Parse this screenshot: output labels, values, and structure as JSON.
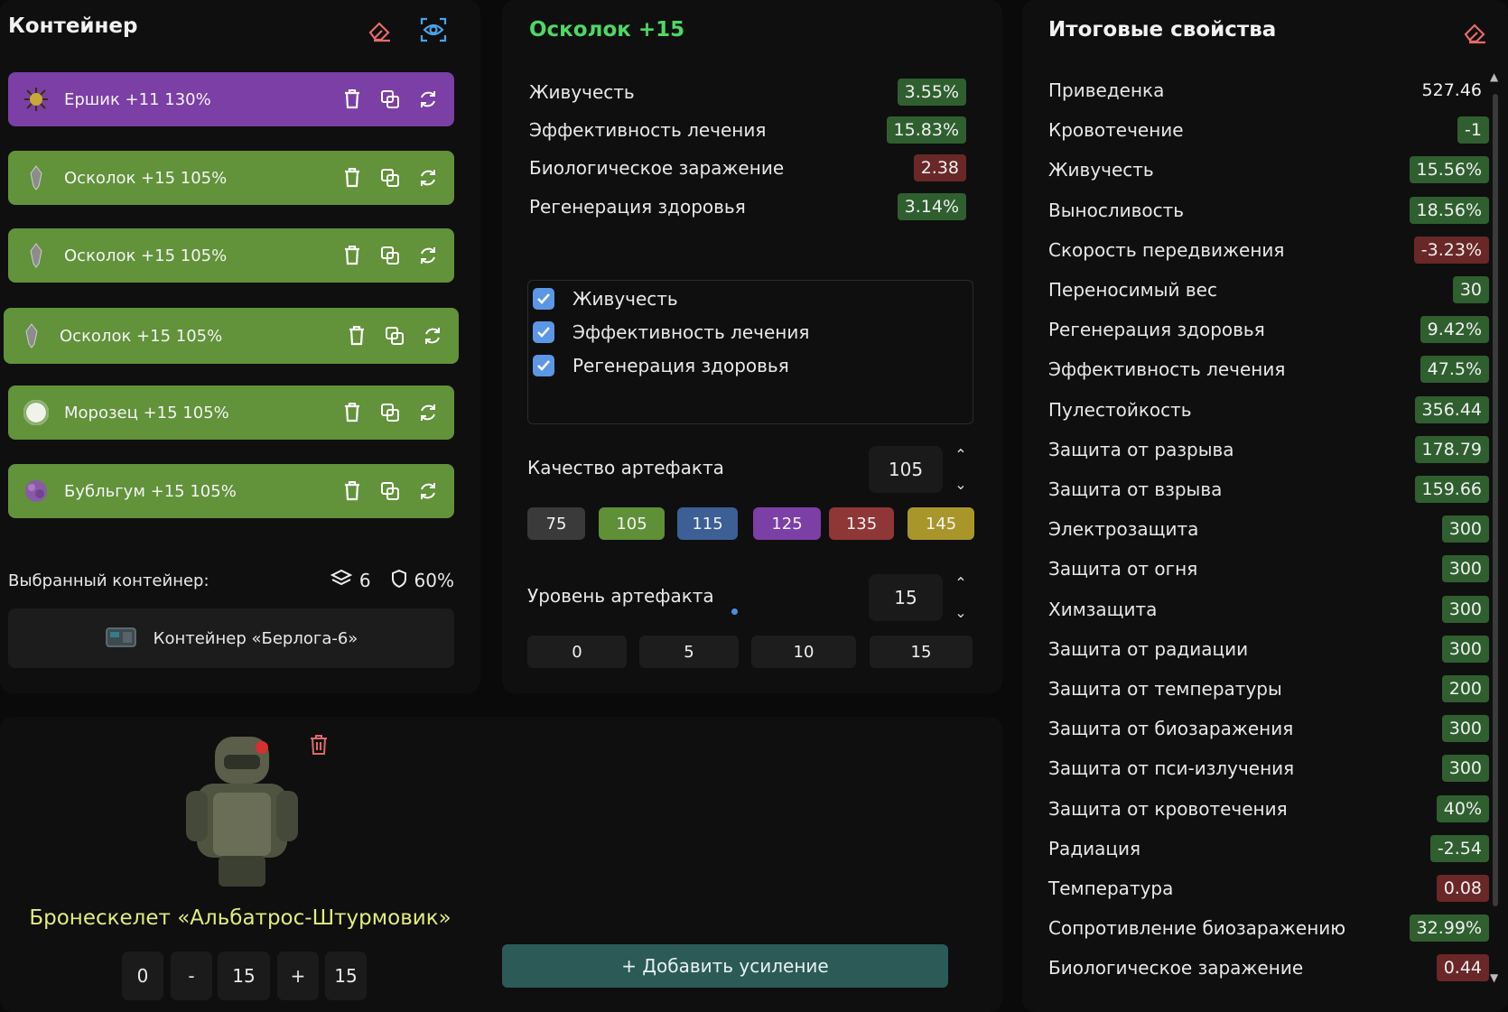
{
  "left": {
    "title": "Контейнер",
    "artifacts": [
      {
        "label": "Ершик +11 130%",
        "color": "#7b3fa6"
      },
      {
        "label": "Осколок +15 105%",
        "color": "#62923a"
      },
      {
        "label": "Осколок +15 105%",
        "color": "#62923a"
      },
      {
        "label": "Осколок +15 105%",
        "color": "#62923a"
      },
      {
        "label": "Морозец +15 105%",
        "color": "#62923a"
      },
      {
        "label": "Бубльгум +15 105%",
        "color": "#62923a"
      }
    ],
    "selected_label": "Выбранный контейнер:",
    "slots": "6",
    "protection": "60%",
    "container_name": "Контейнер «Берлога-6»"
  },
  "middle": {
    "title": "Осколок +15",
    "title_color": "#4cd964",
    "stats": [
      {
        "name": "Живучесть",
        "value": "3.55%",
        "tone": "green"
      },
      {
        "name": "Эффективность лечения",
        "value": "15.83%",
        "tone": "green"
      },
      {
        "name": "Биологическое заражение",
        "value": "2.38",
        "tone": "red"
      },
      {
        "name": "Регенерация здоровья",
        "value": "3.14%",
        "tone": "green"
      }
    ],
    "checks": [
      "Живучесть",
      "Эффективность лечения",
      "Регенерация здоровья"
    ],
    "quality_label": "Качество артефакта",
    "quality_value": "105",
    "quality_presets": [
      {
        "label": "75",
        "color": "#3a3a3a"
      },
      {
        "label": "105",
        "color": "#5f8f37"
      },
      {
        "label": "115",
        "color": "#3c5f95"
      },
      {
        "label": "125",
        "color": "#7b3fa6"
      },
      {
        "label": "135",
        "color": "#8f3636"
      },
      {
        "label": "145",
        "color": "#a8962b"
      }
    ],
    "level_label": "Уровень артефакта",
    "level_value": "15",
    "level_presets": [
      "0",
      "5",
      "10",
      "15"
    ]
  },
  "armor": {
    "name": "Бронескелет «Альбатрос-Штурмовик»",
    "controls": [
      "0",
      "-",
      "15",
      "+",
      "15"
    ]
  },
  "add_button": "+ Добавить усиление",
  "right": {
    "title": "Итоговые свойства",
    "props": [
      {
        "name": "Приведенка",
        "value": "527.46",
        "tone": "none"
      },
      {
        "name": "Кровотечение",
        "value": "-1",
        "tone": "green"
      },
      {
        "name": "Живучесть",
        "value": "15.56%",
        "tone": "green"
      },
      {
        "name": "Выносливость",
        "value": "18.56%",
        "tone": "green"
      },
      {
        "name": "Скорость передвижения",
        "value": "-3.23%",
        "tone": "red"
      },
      {
        "name": "Переносимый вес",
        "value": "30",
        "tone": "green"
      },
      {
        "name": "Регенерация здоровья",
        "value": "9.42%",
        "tone": "green"
      },
      {
        "name": "Эффективность лечения",
        "value": "47.5%",
        "tone": "green"
      },
      {
        "name": "Пулестойкость",
        "value": "356.44",
        "tone": "green"
      },
      {
        "name": "Защита от разрыва",
        "value": "178.79",
        "tone": "green"
      },
      {
        "name": "Защита от взрыва",
        "value": "159.66",
        "tone": "green"
      },
      {
        "name": "Электрозащита",
        "value": "300",
        "tone": "green"
      },
      {
        "name": "Защита от огня",
        "value": "300",
        "tone": "green"
      },
      {
        "name": "Химзащита",
        "value": "300",
        "tone": "green"
      },
      {
        "name": "Защита от радиации",
        "value": "300",
        "tone": "green"
      },
      {
        "name": "Защита от температуры",
        "value": "200",
        "tone": "green"
      },
      {
        "name": "Защита от биозаражения",
        "value": "300",
        "tone": "green"
      },
      {
        "name": "Защита от пси-излучения",
        "value": "300",
        "tone": "green"
      },
      {
        "name": "Защита от кровотечения",
        "value": "40%",
        "tone": "green"
      },
      {
        "name": "Радиация",
        "value": "-2.54",
        "tone": "green"
      },
      {
        "name": "Температура",
        "value": "0.08",
        "tone": "red"
      },
      {
        "name": "Сопротивление биозаражению",
        "value": "32.99%",
        "tone": "green"
      },
      {
        "name": "Биологическое заражение",
        "value": "0.44",
        "tone": "red"
      }
    ]
  }
}
